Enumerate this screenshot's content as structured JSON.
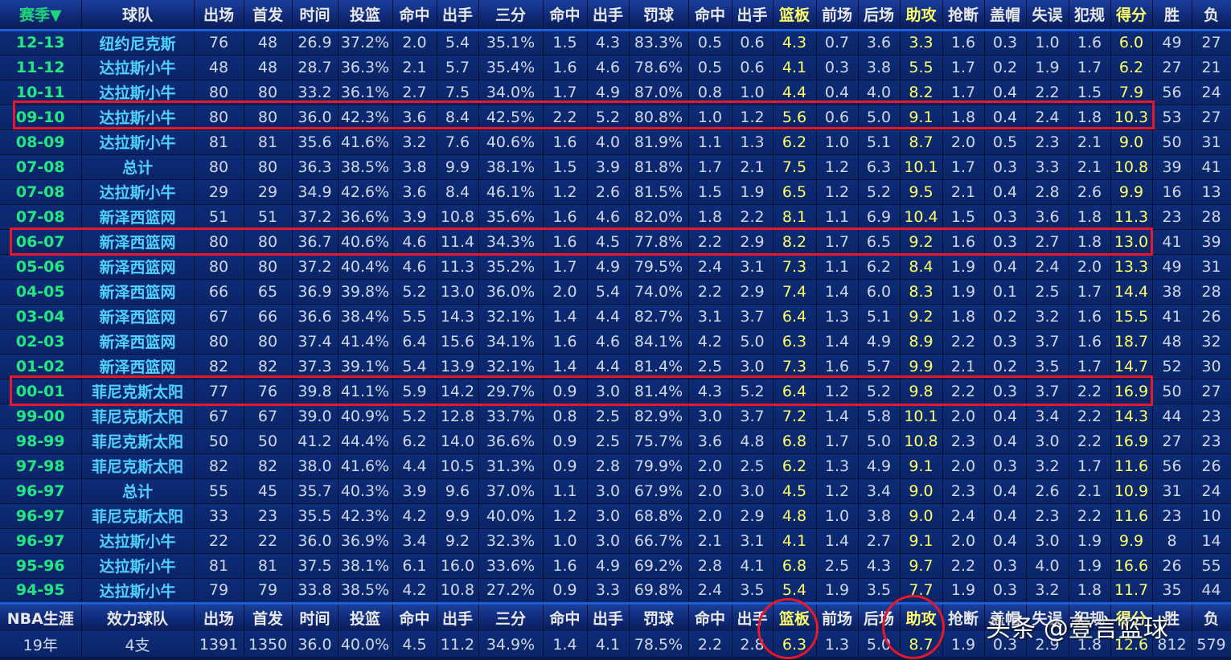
{
  "headers": [
    "赛季▼",
    "球队",
    "出场",
    "首发",
    "时间",
    "投篮",
    "命中",
    "出手",
    "三分",
    "命中",
    "出手",
    "罚球",
    "命中",
    "出手",
    "篮板",
    "前场",
    "后场",
    "助攻",
    "抢断",
    "盖帽",
    "失误",
    "犯规",
    "得分",
    "胜",
    "负"
  ],
  "rows": [
    [
      "12-13",
      "纽约尼克斯",
      "76",
      "48",
      "26.9",
      "37.2%",
      "2.0",
      "5.4",
      "35.1%",
      "1.5",
      "4.3",
      "83.3%",
      "0.5",
      "0.6",
      "4.3",
      "0.7",
      "3.6",
      "3.3",
      "1.6",
      "0.3",
      "1.0",
      "1.6",
      "6.0",
      "49",
      "27"
    ],
    [
      "11-12",
      "达拉斯小牛",
      "48",
      "48",
      "28.7",
      "36.3%",
      "2.1",
      "5.7",
      "35.4%",
      "1.6",
      "4.6",
      "78.6%",
      "0.5",
      "0.6",
      "4.1",
      "0.3",
      "3.8",
      "5.5",
      "1.7",
      "0.2",
      "1.9",
      "1.7",
      "6.2",
      "27",
      "21"
    ],
    [
      "10-11",
      "达拉斯小牛",
      "80",
      "80",
      "33.2",
      "36.1%",
      "2.7",
      "7.5",
      "34.0%",
      "1.7",
      "4.9",
      "87.0%",
      "0.8",
      "1.0",
      "4.4",
      "0.4",
      "4.0",
      "8.2",
      "1.7",
      "0.4",
      "2.2",
      "1.5",
      "7.9",
      "56",
      "24"
    ],
    [
      "09-10",
      "达拉斯小牛",
      "80",
      "80",
      "36.0",
      "42.3%",
      "3.6",
      "8.4",
      "42.5%",
      "2.2",
      "5.2",
      "80.8%",
      "1.0",
      "1.2",
      "5.6",
      "0.6",
      "5.0",
      "9.1",
      "1.8",
      "0.4",
      "2.4",
      "1.8",
      "10.3",
      "53",
      "27"
    ],
    [
      "08-09",
      "达拉斯小牛",
      "81",
      "81",
      "35.6",
      "41.6%",
      "3.2",
      "7.6",
      "40.6%",
      "1.6",
      "4.0",
      "81.9%",
      "1.1",
      "1.3",
      "6.2",
      "1.0",
      "5.1",
      "8.7",
      "2.0",
      "0.5",
      "2.3",
      "2.1",
      "9.0",
      "50",
      "31"
    ],
    [
      "07-08",
      "总计",
      "80",
      "80",
      "36.3",
      "38.5%",
      "3.8",
      "9.9",
      "38.1%",
      "1.5",
      "3.9",
      "81.8%",
      "1.7",
      "2.1",
      "7.5",
      "1.2",
      "6.3",
      "10.1",
      "1.7",
      "0.3",
      "3.3",
      "2.1",
      "10.8",
      "39",
      "41"
    ],
    [
      "07-08",
      "达拉斯小牛",
      "29",
      "29",
      "34.9",
      "42.6%",
      "3.6",
      "8.4",
      "46.1%",
      "1.2",
      "2.6",
      "81.5%",
      "1.5",
      "1.9",
      "6.5",
      "1.2",
      "5.2",
      "9.5",
      "2.1",
      "0.4",
      "2.8",
      "2.6",
      "9.9",
      "16",
      "13"
    ],
    [
      "07-08",
      "新泽西篮网",
      "51",
      "51",
      "37.2",
      "36.6%",
      "3.9",
      "10.8",
      "35.6%",
      "1.6",
      "4.6",
      "82.0%",
      "1.8",
      "2.2",
      "8.1",
      "1.1",
      "6.9",
      "10.4",
      "1.5",
      "0.3",
      "3.6",
      "1.8",
      "11.3",
      "23",
      "28"
    ],
    [
      "06-07",
      "新泽西篮网",
      "80",
      "80",
      "36.7",
      "40.6%",
      "4.6",
      "11.4",
      "34.3%",
      "1.6",
      "4.5",
      "77.8%",
      "2.2",
      "2.9",
      "8.2",
      "1.7",
      "6.5",
      "9.2",
      "1.6",
      "0.3",
      "2.7",
      "1.8",
      "13.0",
      "41",
      "39"
    ],
    [
      "05-06",
      "新泽西篮网",
      "80",
      "80",
      "37.2",
      "40.4%",
      "4.6",
      "11.3",
      "35.2%",
      "1.7",
      "4.9",
      "79.5%",
      "2.4",
      "3.1",
      "7.3",
      "1.1",
      "6.2",
      "8.4",
      "1.9",
      "0.4",
      "2.4",
      "2.0",
      "13.3",
      "49",
      "31"
    ],
    [
      "04-05",
      "新泽西篮网",
      "66",
      "65",
      "36.9",
      "39.8%",
      "5.2",
      "13.0",
      "36.0%",
      "2.0",
      "5.4",
      "74.0%",
      "2.2",
      "2.9",
      "7.4",
      "1.4",
      "6.0",
      "8.3",
      "1.9",
      "0.1",
      "2.5",
      "1.7",
      "14.4",
      "38",
      "28"
    ],
    [
      "03-04",
      "新泽西篮网",
      "67",
      "66",
      "36.6",
      "38.4%",
      "5.5",
      "14.3",
      "32.1%",
      "1.4",
      "4.4",
      "82.7%",
      "3.1",
      "3.7",
      "6.4",
      "1.3",
      "5.1",
      "9.2",
      "1.8",
      "0.2",
      "3.2",
      "1.6",
      "15.5",
      "41",
      "26"
    ],
    [
      "02-03",
      "新泽西篮网",
      "80",
      "80",
      "37.4",
      "41.4%",
      "6.4",
      "15.6",
      "34.1%",
      "1.6",
      "4.6",
      "84.1%",
      "4.2",
      "5.0",
      "6.3",
      "1.4",
      "4.9",
      "8.9",
      "2.2",
      "0.3",
      "3.7",
      "1.6",
      "18.7",
      "48",
      "32"
    ],
    [
      "01-02",
      "新泽西篮网",
      "82",
      "82",
      "37.3",
      "39.1%",
      "5.4",
      "13.9",
      "32.1%",
      "1.4",
      "4.4",
      "81.4%",
      "2.5",
      "3.0",
      "7.3",
      "1.6",
      "5.7",
      "9.9",
      "2.1",
      "0.2",
      "3.5",
      "1.7",
      "14.7",
      "52",
      "30"
    ],
    [
      "00-01",
      "菲尼克斯太阳",
      "77",
      "76",
      "39.8",
      "41.1%",
      "5.9",
      "14.2",
      "29.7%",
      "0.9",
      "3.0",
      "81.4%",
      "4.3",
      "5.2",
      "6.4",
      "1.2",
      "5.2",
      "9.8",
      "2.2",
      "0.3",
      "3.7",
      "2.2",
      "16.9",
      "50",
      "27"
    ],
    [
      "99-00",
      "菲尼克斯太阳",
      "67",
      "67",
      "39.0",
      "40.9%",
      "5.2",
      "12.8",
      "33.7%",
      "0.8",
      "2.5",
      "82.9%",
      "3.0",
      "3.7",
      "7.2",
      "1.4",
      "5.8",
      "10.1",
      "2.0",
      "0.4",
      "3.4",
      "2.2",
      "14.3",
      "44",
      "23"
    ],
    [
      "98-99",
      "菲尼克斯太阳",
      "50",
      "50",
      "41.2",
      "44.4%",
      "6.2",
      "14.0",
      "36.6%",
      "0.9",
      "2.5",
      "75.7%",
      "3.6",
      "4.8",
      "6.8",
      "1.7",
      "5.0",
      "10.8",
      "2.3",
      "0.4",
      "3.0",
      "2.2",
      "16.9",
      "27",
      "23"
    ],
    [
      "97-98",
      "菲尼克斯太阳",
      "82",
      "82",
      "38.0",
      "41.6%",
      "4.4",
      "10.5",
      "31.3%",
      "0.9",
      "2.8",
      "79.9%",
      "2.0",
      "2.5",
      "6.2",
      "1.3",
      "4.9",
      "9.1",
      "2.0",
      "0.3",
      "3.2",
      "1.7",
      "11.6",
      "56",
      "26"
    ],
    [
      "96-97",
      "总计",
      "55",
      "45",
      "35.7",
      "40.3%",
      "3.9",
      "9.6",
      "37.0%",
      "1.1",
      "3.0",
      "67.9%",
      "2.0",
      "3.0",
      "4.5",
      "1.2",
      "3.4",
      "9.0",
      "2.3",
      "0.4",
      "2.6",
      "2.1",
      "10.9",
      "31",
      "24"
    ],
    [
      "96-97",
      "菲尼克斯太阳",
      "33",
      "23",
      "35.5",
      "42.3%",
      "4.2",
      "9.9",
      "40.0%",
      "1.2",
      "3.0",
      "68.8%",
      "2.0",
      "2.9",
      "4.8",
      "1.0",
      "3.8",
      "9.0",
      "2.4",
      "0.4",
      "2.3",
      "2.2",
      "11.6",
      "23",
      "10"
    ],
    [
      "96-97",
      "达拉斯小牛",
      "22",
      "22",
      "36.0",
      "36.9%",
      "3.4",
      "9.2",
      "32.3%",
      "1.0",
      "3.0",
      "66.7%",
      "2.1",
      "3.1",
      "4.1",
      "1.4",
      "2.7",
      "9.1",
      "2.0",
      "0.4",
      "3.0",
      "1.9",
      "9.9",
      "8",
      "14"
    ],
    [
      "95-96",
      "达拉斯小牛",
      "81",
      "81",
      "37.5",
      "38.1%",
      "6.1",
      "16.0",
      "33.6%",
      "1.6",
      "4.9",
      "69.2%",
      "2.8",
      "4.1",
      "6.8",
      "2.5",
      "4.3",
      "9.7",
      "2.2",
      "0.3",
      "4.0",
      "1.9",
      "16.6",
      "26",
      "55"
    ],
    [
      "94-95",
      "达拉斯小牛",
      "79",
      "79",
      "33.8",
      "38.5%",
      "4.2",
      "10.8",
      "27.2%",
      "0.9",
      "3.3",
      "69.8%",
      "2.4",
      "3.5",
      "5.4",
      "1.9",
      "3.5",
      "7.7",
      "1.9",
      "0.3",
      "3.2",
      "1.8",
      "11.7",
      "35",
      "44"
    ]
  ],
  "footer_headers": [
    "NBA生涯",
    "效力球队",
    "出场",
    "首发",
    "时间",
    "投篮",
    "命中",
    "出手",
    "三分",
    "命中",
    "出手",
    "罚球",
    "命中",
    "出手",
    "篮板",
    "前场",
    "后场",
    "助攻",
    "抢断",
    "盖帽",
    "失误",
    "犯规",
    "得分",
    "胜",
    "负"
  ],
  "footer_values": [
    "19年",
    "4支",
    "1391",
    "1350",
    "36.0",
    "40.0%",
    "4.5",
    "11.2",
    "34.9%",
    "1.4",
    "4.1",
    "78.5%",
    "2.2",
    "2.8",
    "6.3",
    "1.3",
    "5.0",
    "8.7",
    "1.9",
    "0.3",
    "2.9",
    "1.8",
    "12.6",
    "812",
    "579"
  ],
  "highlight_columns": [
    14,
    17,
    22
  ],
  "watermark": "头条 @壹言篮球",
  "colors": {
    "header_bg": "#123284",
    "row_bg": "#0b2870",
    "season_text": "#22e882",
    "team_text": "#4fd2ff",
    "highlight_text": "#ffff66",
    "annotation_red": "#e8182a"
  }
}
